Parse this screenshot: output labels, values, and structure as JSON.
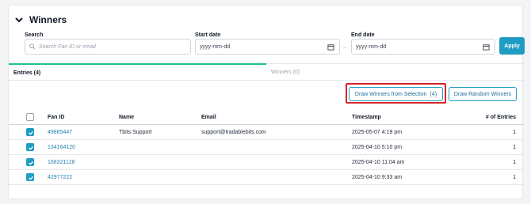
{
  "header": {
    "title": "Winners",
    "toggle_icon": "chevron-down-icon"
  },
  "filters": {
    "search": {
      "label": "Search",
      "placeholder": "Search Fan ID or email"
    },
    "start_date": {
      "label": "Start date",
      "value": "yyyy-mm-dd"
    },
    "end_date": {
      "label": "End date",
      "value": "yyyy-mm-dd"
    },
    "separator": "–",
    "apply_label": "Apply"
  },
  "tabs": [
    {
      "label": "Entries (4)",
      "active": true
    },
    {
      "label": "Winners (0)",
      "active": false
    }
  ],
  "actions": {
    "draw_selection_label": "Draw Winners from Selection",
    "draw_selection_count": "(4)",
    "draw_random_label": "Draw Random Winners"
  },
  "table": {
    "columns": [
      "Fan ID",
      "Name",
      "Email",
      "Timestamp",
      "# of Entries"
    ],
    "rows": [
      {
        "fan_id": "49865447",
        "name": "Tbits Support",
        "email": "support@tradablebits.com",
        "timestamp": "2025-05-07 4:19 pm",
        "entries": "1",
        "checked": true
      },
      {
        "fan_id": "134164120",
        "name": "",
        "email": "",
        "timestamp": "2025-04-10 5:10 pm",
        "entries": "1",
        "checked": true
      },
      {
        "fan_id": "168321128",
        "name": "",
        "email": "",
        "timestamp": "2025-04-10 11:04 am",
        "entries": "1",
        "checked": true
      },
      {
        "fan_id": "42977222",
        "name": "",
        "email": "",
        "timestamp": "2025-04-10 9:33 am",
        "entries": "1",
        "checked": true
      }
    ]
  },
  "colors": {
    "accent": "#1f9cc4",
    "tab_active": "#1fbf8f",
    "highlight": "#d9262c"
  }
}
